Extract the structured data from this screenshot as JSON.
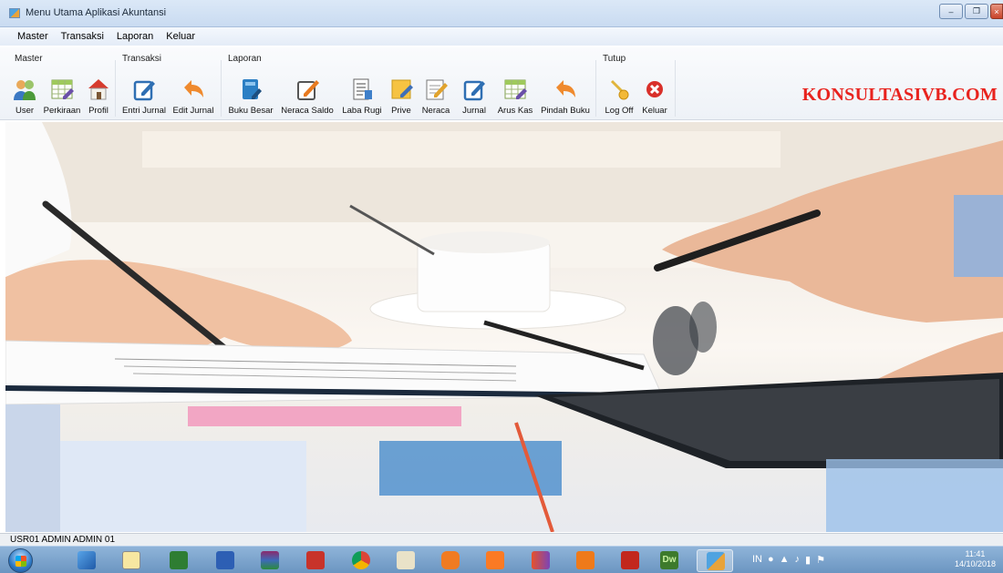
{
  "window": {
    "title": "Menu Utama Aplikasi Akuntansi"
  },
  "menubar": {
    "items": [
      "Master",
      "Transaksi",
      "Laporan",
      "Keluar"
    ]
  },
  "toolbar": {
    "groups": {
      "master": "Master",
      "transaksi": "Transaksi",
      "laporan": "Laporan",
      "tutup": "Tutup"
    },
    "buttons": {
      "user": "User",
      "perkiraan": "Perkiraan",
      "profil": "Profil",
      "entri_jurnal": "Entri Jurnal",
      "edit_jurnal": "Edit Jurnal",
      "buku_besar": "Buku Besar",
      "neraca_saldo": "Neraca Saldo",
      "laba_rugi": "Laba Rugi",
      "prive": "Prive",
      "neraca": "Neraca",
      "jurnal": "Jurnal",
      "arus_kas": "Arus Kas",
      "pindah_buku": "Pindah Buku",
      "log_off": "Log Off",
      "keluar": "Keluar"
    },
    "brand": "KONSULTASIVB.COM"
  },
  "statusbar": {
    "text": "USR01  ADMIN  ADMIN  01"
  },
  "taskbar": {
    "apps": [
      "explorer",
      "notepad",
      "excel",
      "word",
      "winrar",
      "filezilla",
      "chrome",
      "network",
      "avast",
      "xampp",
      "vb6",
      "vlc",
      "acrobat",
      "dreamweaver",
      "accounting-app"
    ],
    "input_language": "IN",
    "time": "11:41",
    "date": "14/10/2018"
  },
  "colors": {
    "brand": "#e8231e",
    "titlebar": "#c9dbf1",
    "taskbar": "#6b95c1"
  }
}
